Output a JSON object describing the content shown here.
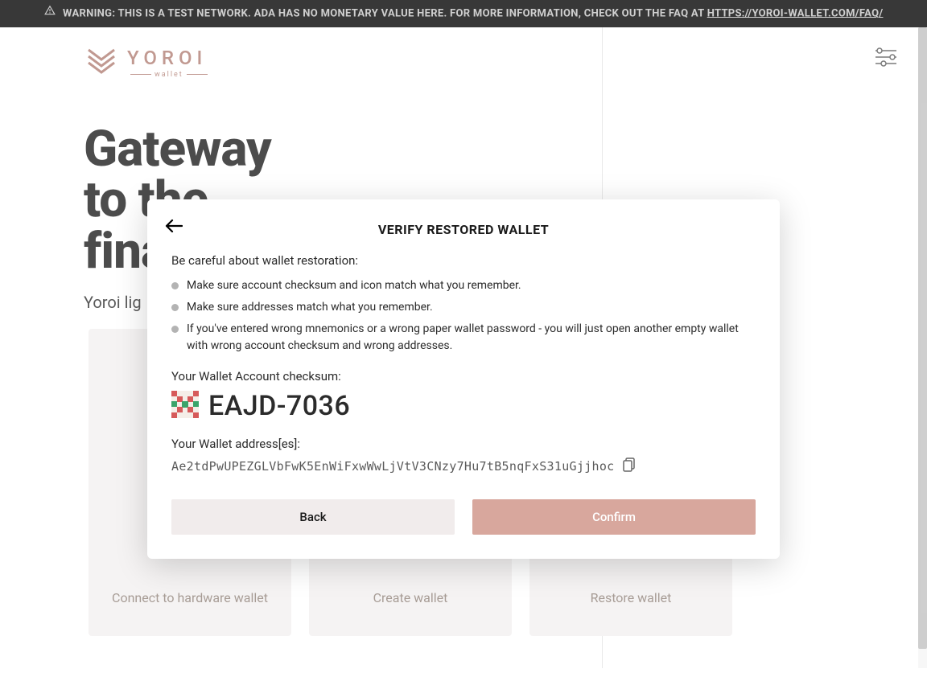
{
  "banner": {
    "text_before_link": "WARNING: THIS IS A TEST NETWORK. ADA HAS NO MONETARY VALUE HERE. FOR MORE INFORMATION, CHECK OUT THE FAQ AT ",
    "link_text": "HTTPS://YOROI-WALLET.COM/FAQ/"
  },
  "brand": {
    "name": "YOROI",
    "sub": "wallet"
  },
  "hero": {
    "line1": "Gateway",
    "line2": "to the",
    "line3": "financial",
    "sub_visible": "Yoroi lig"
  },
  "cards": {
    "hardware": "Connect to hardware wallet",
    "create": "Create wallet",
    "restore": "Restore wallet"
  },
  "modal": {
    "title": "VERIFY RESTORED WALLET",
    "intro": "Be careful about wallet restoration:",
    "bullets": [
      "Make sure account checksum and icon match what you remember.",
      "Make sure addresses match what you remember.",
      "If you've entered wrong mnemonics or a wrong paper wallet password - you will just open another empty wallet with wrong account checksum and wrong addresses."
    ],
    "checksum_label": "Your Wallet Account checksum:",
    "checksum_value": "EAJD-7036",
    "address_label": "Your Wallet address[es]:",
    "address_value": "Ae2tdPwUPEZGLVbFwK5EnWiFxwWwLjVtV3CNzy7Hu7tB5nqFxS31uGjjhoc",
    "back": "Back",
    "confirm": "Confirm"
  },
  "colors": {
    "accent": "#d8a79d",
    "brand": "#b07d72"
  }
}
